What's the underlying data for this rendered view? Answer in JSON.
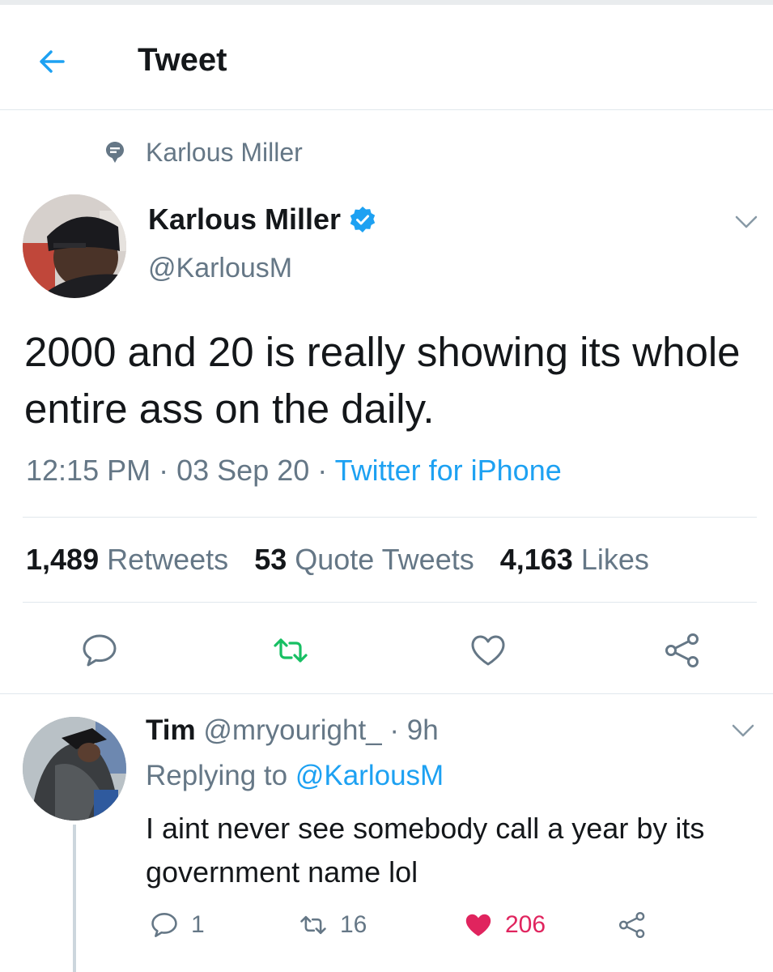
{
  "header": {
    "title": "Tweet",
    "back_icon": "arrow-left-icon"
  },
  "pinned": {
    "label": "Karlous Miller",
    "icon": "pin-icon"
  },
  "tweet": {
    "author_name": "Karlous Miller",
    "author_handle": "@KarlousM",
    "verified": true,
    "text": "2000 and 20 is really showing its whole entire ass on the daily.",
    "time": "12:15 PM",
    "date": "03 Sep 20",
    "source": "Twitter for iPhone",
    "stats": {
      "retweets_count": "1,489",
      "retweets_label": "Retweets",
      "quotes_count": "53",
      "quotes_label": "Quote Tweets",
      "likes_count": "4,163",
      "likes_label": "Likes"
    }
  },
  "reply": {
    "name": "Tim",
    "handle_time": "@mryouright_ · 9h",
    "replying_prefix": "Replying to",
    "replying_to": "@KarlousM",
    "text": "I aint never see somebody call a year by its government name lol",
    "replies": "1",
    "retweets": "16",
    "likes": "206"
  },
  "colors": {
    "accent": "#1da1f2",
    "retweet": "#17bf63",
    "like": "#e0245e",
    "secondary_text": "#657786"
  }
}
